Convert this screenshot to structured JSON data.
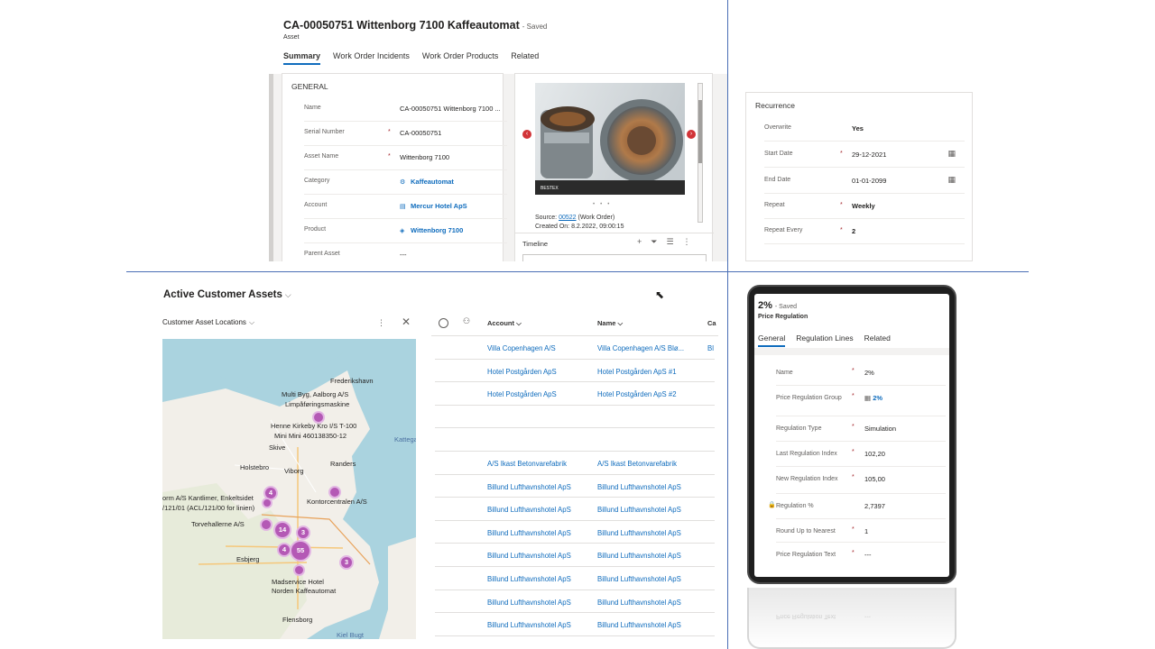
{
  "asset": {
    "title": "CA-00050751 Wittenborg 7100 Kaffeautomat",
    "saved": "- Saved",
    "entity": "Asset",
    "tabs": [
      "Summary",
      "Work Order Incidents",
      "Work Order Products",
      "Related"
    ],
    "section": "GENERAL",
    "fields": [
      {
        "label": "Name",
        "value": "CA-00050751 Wittenborg 7100 ...",
        "required": false,
        "link": false
      },
      {
        "label": "Serial Number",
        "value": "CA-00050751",
        "required": true,
        "link": false
      },
      {
        "label": "Asset Name",
        "value": "Wittenborg 7100",
        "required": true,
        "link": false
      },
      {
        "label": "Category",
        "value": "Kaffeautomat",
        "required": false,
        "link": true,
        "icon": "category-icon"
      },
      {
        "label": "Account",
        "value": "Mercur Hotel ApS",
        "required": false,
        "link": true,
        "icon": "account-icon"
      },
      {
        "label": "Product",
        "value": "Wittenborg 7100",
        "required": false,
        "link": true,
        "icon": "product-icon"
      },
      {
        "label": "Parent Asset",
        "value": "---",
        "required": false,
        "link": false
      }
    ],
    "media": {
      "source_prefix": "Source:",
      "source_link": "00522",
      "source_suffix": "(Work Order)",
      "created": "Created On: 8.2.2022, 09:00:15",
      "timeline": "Timeline",
      "photo_caption": "BESTEX"
    }
  },
  "recurrence": {
    "section": "Recurrence",
    "fields": [
      {
        "label": "Overwrite",
        "value": "Yes",
        "required": false,
        "bold": true
      },
      {
        "label": "Start Date",
        "value": "29-12-2021",
        "required": true,
        "bold": false,
        "calendar": true
      },
      {
        "label": "End Date",
        "value": "01-01-2099",
        "required": false,
        "bold": false,
        "calendar": true
      },
      {
        "label": "Repeat",
        "value": "Weekly",
        "required": true,
        "bold": true
      },
      {
        "label": "Repeat Every",
        "value": "2",
        "required": true,
        "bold": true
      }
    ]
  },
  "customer_assets": {
    "title": "Active Customer Assets",
    "map_title": "Customer Asset Locations",
    "map_labels": [
      "Frederikshavn",
      "Multi Byg, Aalborg A/S",
      "Limpåføringsmaskine",
      "Henne Kirkeby Kro I/S T-100",
      "Mini Mini 460138350-12",
      "Skive",
      "Holstebro",
      "Viborg",
      "Randers",
      "Kattegat",
      "orm A/S Kantlimer, Enkeltsidet",
      "/121/01 (ACL/121/00 for linien)",
      "Kontorcentralen A/S",
      "Torvehallerne A/S",
      "Esbjerg",
      "Madservice Hotel",
      "Norden Kaffeautomat",
      "Flensborg",
      "Kiel Bugt"
    ],
    "clusters": [
      "4",
      "14",
      "3",
      "4",
      "55",
      "3"
    ],
    "columns": [
      "Account",
      "Name",
      "Ca"
    ],
    "rows": [
      [
        "Villa Copenhagen A/S",
        "Villa Copenhagen A/S Blø...",
        "Bl"
      ],
      [
        "Hotel Postgården ApS",
        "Hotel Postgården ApS #1",
        ""
      ],
      [
        "Hotel Postgården ApS",
        "Hotel Postgården ApS #2",
        ""
      ],
      [
        "",
        "",
        ""
      ],
      [
        "",
        "",
        ""
      ],
      [
        "A/S Ikast Betonvarefabrik",
        "A/S Ikast Betonvarefabrik",
        ""
      ],
      [
        "Billund Lufthavnshotel ApS",
        "Billund Lufthavnshotel ApS",
        ""
      ],
      [
        "Billund Lufthavnshotel ApS",
        "Billund Lufthavnshotel ApS",
        ""
      ],
      [
        "Billund Lufthavnshotel ApS",
        "Billund Lufthavnshotel ApS",
        ""
      ],
      [
        "Billund Lufthavnshotel ApS",
        "Billund Lufthavnshotel ApS",
        ""
      ],
      [
        "Billund Lufthavnshotel ApS",
        "Billund Lufthavnshotel ApS",
        ""
      ],
      [
        "Billund Lufthavnshotel ApS",
        "Billund Lufthavnshotel ApS",
        ""
      ],
      [
        "Billund Lufthavnshotel ApS",
        "Billund Lufthavnshotel ApS",
        ""
      ]
    ]
  },
  "price_regulation": {
    "title": "2%",
    "saved": "- Saved",
    "entity": "Price Regulation",
    "tabs": [
      "General",
      "Regulation Lines",
      "Related"
    ],
    "fields": [
      {
        "label": "Name",
        "value": "2%",
        "required": true,
        "link": false
      },
      {
        "label": "Price Regulation Group",
        "value": "2%",
        "required": true,
        "link": true
      },
      {
        "label": "Regulation Type",
        "value": "Simulation",
        "required": true,
        "link": false
      },
      {
        "label": "Last Regulation Index",
        "value": "102,20",
        "required": true,
        "link": false
      },
      {
        "label": "New Regulation Index",
        "value": "105,00",
        "required": true,
        "link": false
      },
      {
        "label": "Regulation %",
        "value": "2,7397",
        "required": false,
        "link": false,
        "locked": true
      },
      {
        "label": "Round Up to Nearest",
        "value": "1",
        "required": true,
        "link": false
      },
      {
        "label": "Price Regulation Text",
        "value": "---",
        "required": true,
        "link": false
      }
    ]
  },
  "colors": {
    "accent": "#0f6cbd",
    "required": "#a4262c",
    "cluster": "#b459b5",
    "divider": "#4a6fb5"
  }
}
